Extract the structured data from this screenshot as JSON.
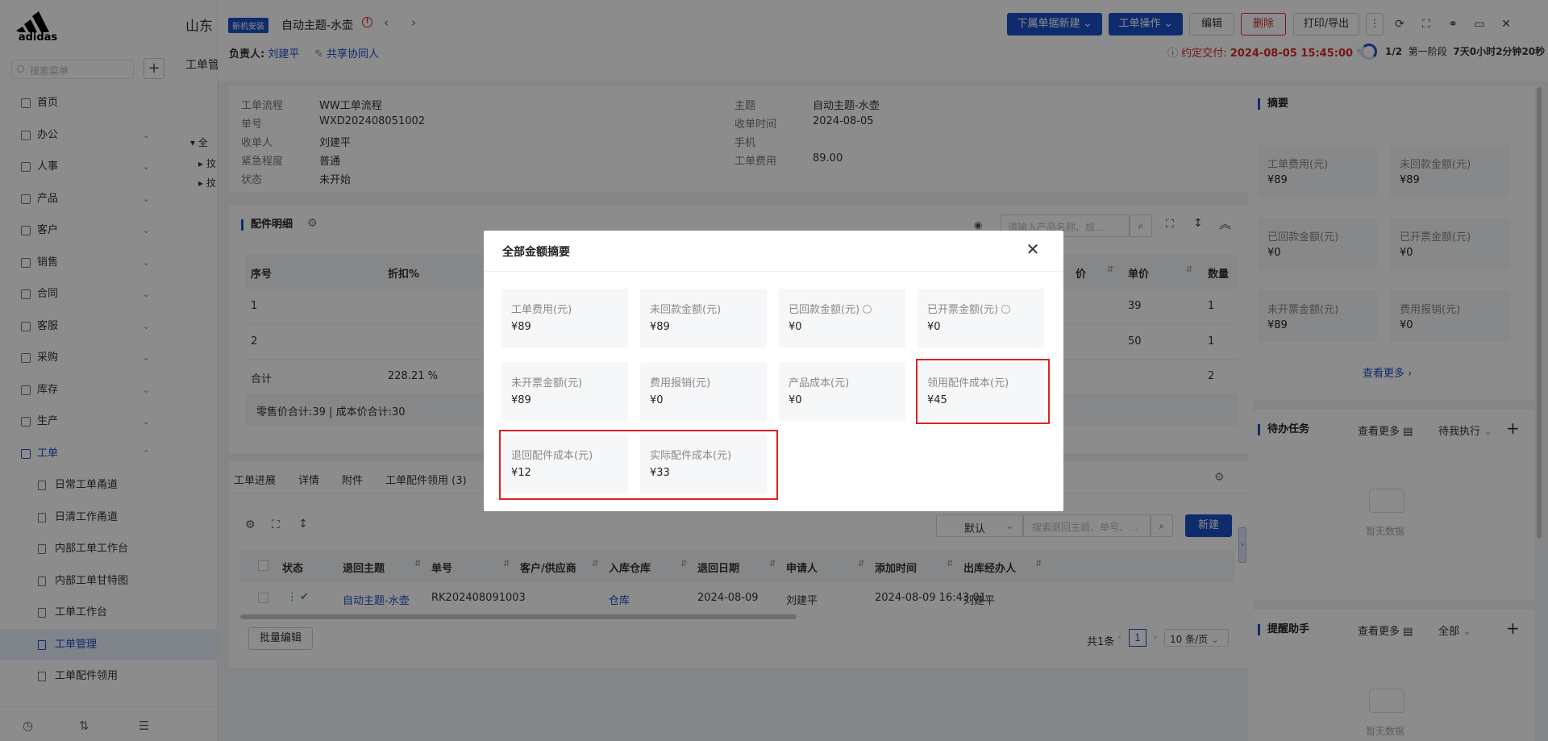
{
  "sidebar": {
    "search_placeholder": "搜索菜单",
    "menu": [
      {
        "label": "首页"
      },
      {
        "label": "办公",
        "chevron": "⌄"
      },
      {
        "label": "人事",
        "chevron": "⌄"
      },
      {
        "label": "产品",
        "chevron": "⌄"
      },
      {
        "label": "客户",
        "chevron": "⌄"
      },
      {
        "label": "销售",
        "chevron": "⌄"
      },
      {
        "label": "合同",
        "chevron": "⌄"
      },
      {
        "label": "客服",
        "chevron": "⌄"
      },
      {
        "label": "采购",
        "chevron": "⌄"
      },
      {
        "label": "库存",
        "chevron": "⌄"
      },
      {
        "label": "生产",
        "chevron": "⌄"
      },
      {
        "label": "工单",
        "chevron": "⌃"
      }
    ],
    "submenu": [
      "日常工单甬道",
      "日清工作甬道",
      "内部工单工作台",
      "内部工单甘特图",
      "工单工作台",
      "工单管理",
      "工单配件领用"
    ],
    "active_submenu": "工单管理"
  },
  "behind": {
    "company": "山东",
    "crumb": "工单管",
    "tree_a": "全",
    "tree_b": "抆",
    "tree_c": "抆"
  },
  "header": {
    "badge": "新机安装",
    "title": "自动主题-水壶",
    "owner_label": "负责人:",
    "owner_name": "刘建平",
    "share": "共享协同人",
    "buttons": {
      "sub_new": "下属单据新建",
      "operate": "工单操作",
      "edit": "编辑",
      "delete": "删除",
      "print": "打印/导出"
    },
    "deadline_label": "约定交付:",
    "deadline_value": "2024-08-05 15:45:00",
    "stage_count": "1/2",
    "stage_name": "第一阶段",
    "stage_time": "7天0小时2分钟20秒"
  },
  "info": {
    "left": [
      {
        "label": "工单流程",
        "value": "WW工单流程"
      },
      {
        "label": "单号",
        "value": "WXD202408051002"
      },
      {
        "label": "收单人",
        "value": "刘建平"
      },
      {
        "label": "紧急程度",
        "value": "普通"
      },
      {
        "label": "状态",
        "value": "未开始"
      }
    ],
    "right": [
      {
        "label": "主题",
        "value": "自动主题-水壶"
      },
      {
        "label": "收单时间",
        "value": "2024-08-05"
      },
      {
        "label": "手机",
        "value": ""
      },
      {
        "label": "工单费用",
        "value": "89.00"
      }
    ]
  },
  "parts": {
    "title": "配件明细",
    "search_placeholder": "请输入产品名称、规...",
    "headers": {
      "seq": "序号",
      "discount": "折扣%",
      "price_tail": "价",
      "unit_price": "单价",
      "qty": "数量"
    },
    "rows": [
      {
        "seq": "1",
        "unit_price": "39",
        "qty": "1"
      },
      {
        "seq": "2",
        "unit_price": "50",
        "qty": "1"
      }
    ],
    "total": {
      "label": "合计",
      "discount": "228.21 %",
      "qty": "2"
    },
    "footer": "零售价合计:39 |   成本价合计:30"
  },
  "tabs": [
    "工单进展",
    "详情",
    "附件",
    "工单配件领用 (3)"
  ],
  "returns": {
    "default_select": "默认",
    "search_placeholder": "搜索退回主题、单号、...",
    "new_button": "新建",
    "headers": [
      "状态",
      "退回主题",
      "单号",
      "客户/供应商",
      "入库仓库",
      "退回日期",
      "申请人",
      "添加时间",
      "出库经办人"
    ],
    "row": {
      "subject": "自动主题-水壶",
      "no": "RK202408091003",
      "warehouse": "仓库",
      "date": "2024-08-09",
      "applicant": "刘建平",
      "added": "2024-08-09 16:43:01",
      "handler": "刘建平"
    },
    "batch_edit": "批量编辑",
    "total": "共1条",
    "page": "1",
    "page_size": "10 条/页"
  },
  "summary": {
    "title": "摘要",
    "tiles": [
      {
        "label": "工单费用(元)",
        "value": "¥89"
      },
      {
        "label": "未回款金额(元)",
        "value": "¥89"
      },
      {
        "label": "已回款金额(元)",
        "value": "¥0"
      },
      {
        "label": "已开票金额(元)",
        "value": "¥0"
      },
      {
        "label": "未开票金额(元)",
        "value": "¥89"
      },
      {
        "label": "费用报销(元)",
        "value": "¥0"
      }
    ],
    "more": "查看更多"
  },
  "todo": {
    "title": "待办任务",
    "more": "查看更多",
    "filter": "待我执行",
    "empty": "暂无数据"
  },
  "reminder": {
    "title": "提醒助手",
    "more": "查看更多",
    "filter": "全部",
    "empty": "暂无数据"
  },
  "modal": {
    "title": "全部金额摘要",
    "tiles": [
      {
        "label": "工单费用(元)",
        "value": "¥89"
      },
      {
        "label": "未回款金额(元)",
        "value": "¥89"
      },
      {
        "label": "已回款金额(元)",
        "value": "¥0"
      },
      {
        "label": "已开票金额(元)",
        "value": "¥0"
      },
      {
        "label": "未开票金额(元)",
        "value": "¥89"
      },
      {
        "label": "费用报销(元)",
        "value": "¥0"
      },
      {
        "label": "产品成本(元)",
        "value": "¥0"
      },
      {
        "label": "领用配件成本(元)",
        "value": "¥45"
      },
      {
        "label": "退回配件成本(元)",
        "value": "¥12"
      },
      {
        "label": "实际配件成本(元)",
        "value": "¥33"
      }
    ]
  },
  "colors": {
    "accent": "#1a4fc6",
    "danger": "#d92b2b",
    "highlight": "#e02020"
  }
}
